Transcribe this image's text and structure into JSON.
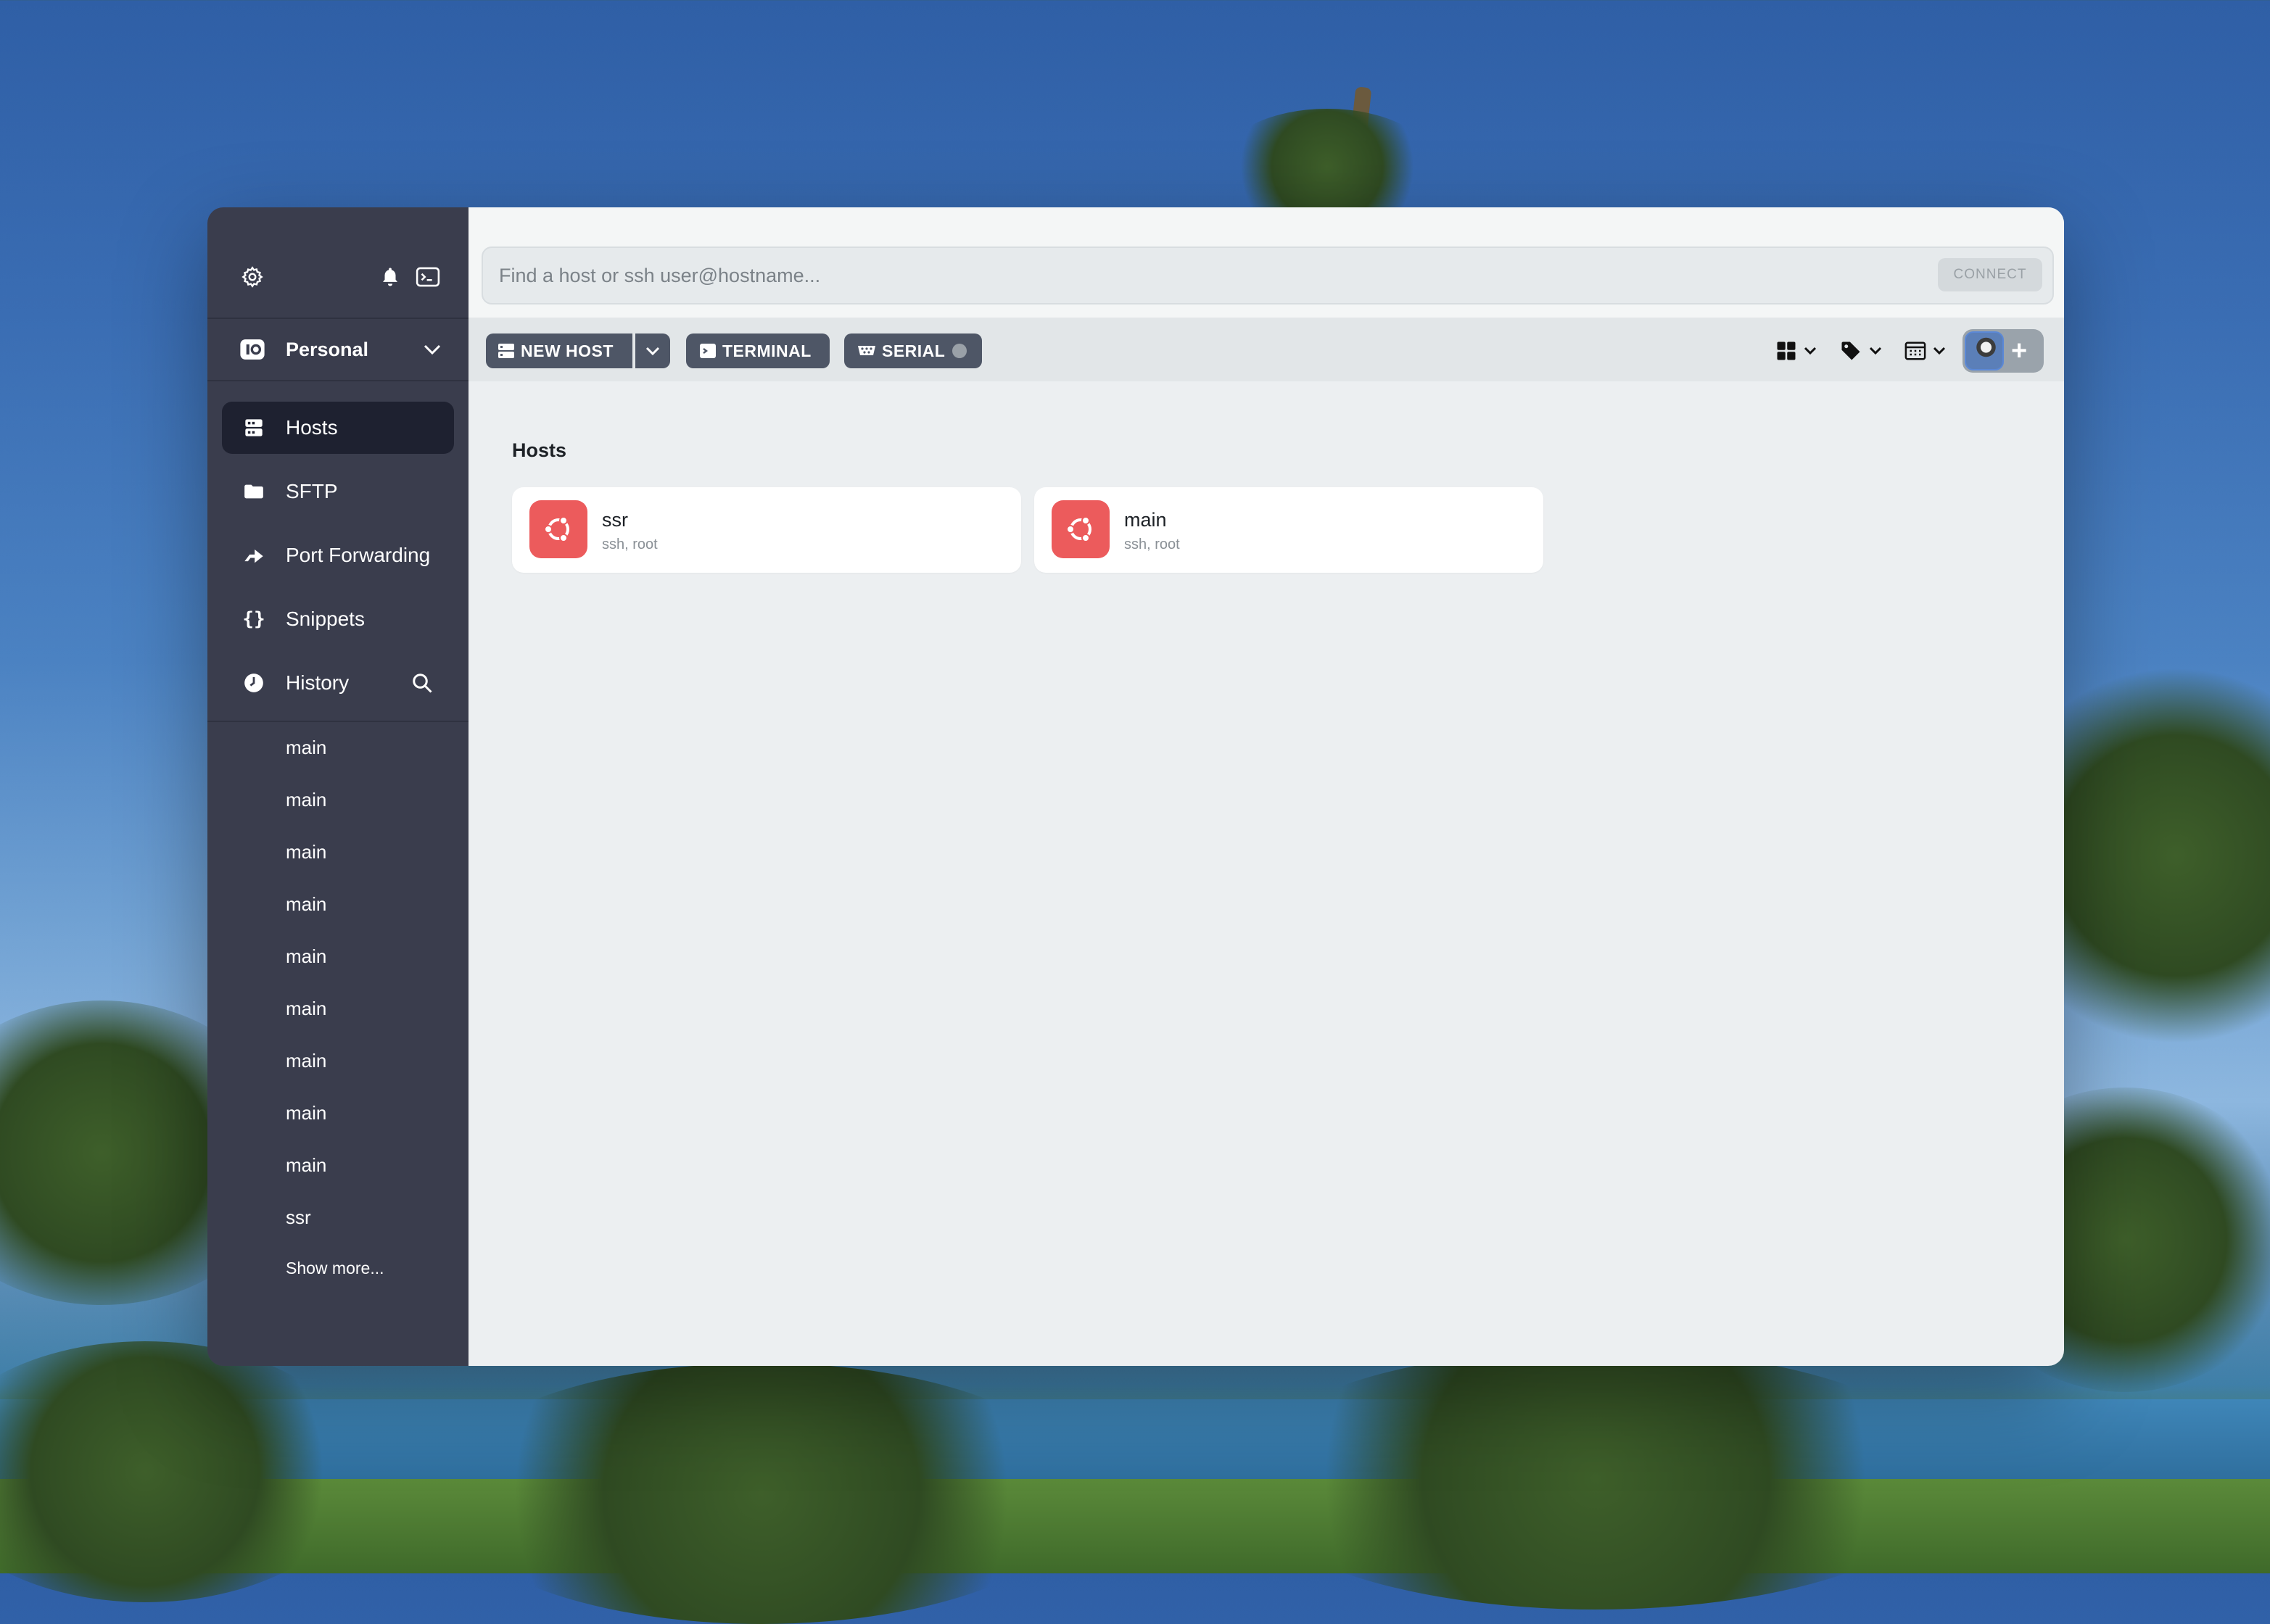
{
  "sidebar": {
    "vault_name": "Personal",
    "nav": [
      {
        "label": "Hosts",
        "icon": "hosts-icon",
        "active": true
      },
      {
        "label": "SFTP",
        "icon": "folder-icon"
      },
      {
        "label": "Port Forwarding",
        "icon": "port-forwarding-icon"
      },
      {
        "label": "Snippets",
        "icon": "braces-icon"
      },
      {
        "label": "History",
        "icon": "clock-icon"
      }
    ],
    "history": [
      "main",
      "main",
      "main",
      "main",
      "main",
      "main",
      "main",
      "main",
      "main",
      "ssr"
    ],
    "show_more": "Show more..."
  },
  "search": {
    "placeholder": "Find a host or ssh user@hostname...",
    "connect_label": "CONNECT"
  },
  "toolbar": {
    "new_host_label": "NEW HOST",
    "terminal_label": "TERMINAL",
    "serial_label": "SERIAL"
  },
  "content": {
    "section_title": "Hosts",
    "hosts": [
      {
        "name": "ssr",
        "details": "ssh, root",
        "os_icon": "ubuntu-icon"
      },
      {
        "name": "main",
        "details": "ssh, root",
        "os_icon": "ubuntu-icon"
      }
    ]
  },
  "colors": {
    "sidebar_bg": "#3a3d4d",
    "active_item_bg": "#1e2130",
    "main_bg": "#eceff1",
    "button_bg": "#4e5666",
    "ubuntu_accent": "#ec5b5c"
  }
}
